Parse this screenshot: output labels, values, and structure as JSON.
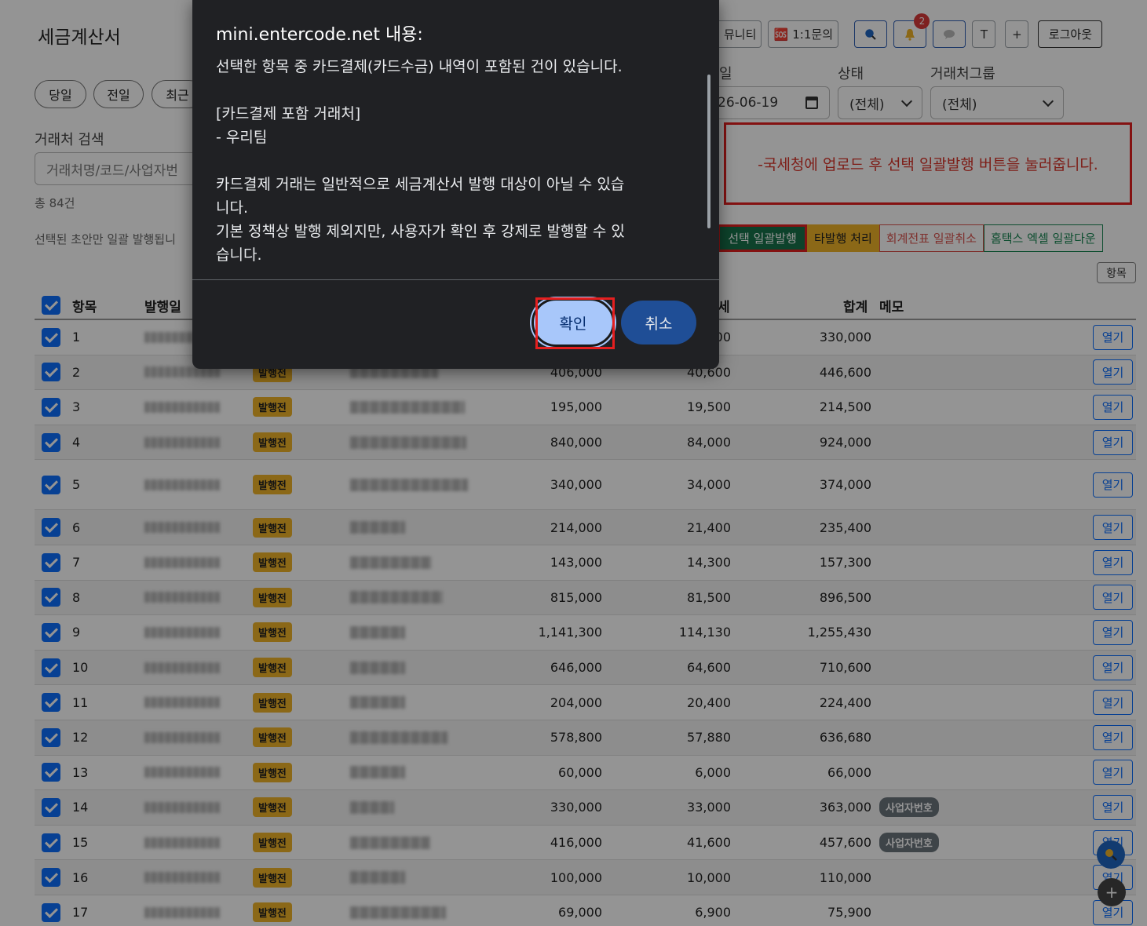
{
  "page": {
    "title": "세금계산서"
  },
  "top_actions": {
    "community": "뮤니티",
    "inquiry": "🆘 1:1문의",
    "search_icon": "search-icon",
    "notifications": "2",
    "chat_icon": "chat-icon",
    "t_label": "T",
    "plus_label": "+",
    "logout": "로그아웃"
  },
  "date_chips": [
    "당일",
    "전일",
    "최근"
  ],
  "filters": {
    "date_partial_label": "일",
    "date_value": "26-06-19",
    "status_label": "상태",
    "status_value": "(전체)",
    "group_label": "거래처그룹",
    "group_value": "(전체)"
  },
  "search": {
    "label": "거래처 검색",
    "placeholder": "거래처명/코드/사업자번"
  },
  "total_count": "총 84건",
  "hint": "선택된 초안만 일괄 발행됩니",
  "annotation": "-국세청에 업로드 후 선택 일괄발행 버튼을 눌러줍니다.",
  "actions": {
    "batch_issue": "선택 일괄발행",
    "other_issue": "타발행 처리",
    "cancel_voucher": "회계전표 일괄취소",
    "hometax_download": "홈택스 엑셀 일괄다운"
  },
  "columns_button": "항목",
  "table": {
    "headers": {
      "item": "항목",
      "issue_date": "발행일",
      "tax": "세",
      "total": "합계",
      "memo": "메모"
    },
    "status_label": "발행전",
    "open_label": "열기",
    "rows": [
      {
        "no": "1",
        "supply": "",
        "tax": "00",
        "total": "330,000",
        "memo": ""
      },
      {
        "no": "2",
        "supply": "406,000",
        "tax": "40,600",
        "total": "446,600",
        "memo": ""
      },
      {
        "no": "3",
        "supply": "195,000",
        "tax": "19,500",
        "total": "214,500",
        "memo": ""
      },
      {
        "no": "4",
        "supply": "840,000",
        "tax": "84,000",
        "total": "924,000",
        "memo": ""
      },
      {
        "no": "5",
        "supply": "340,000",
        "tax": "34,000",
        "total": "374,000",
        "memo": ""
      },
      {
        "no": "6",
        "supply": "214,000",
        "tax": "21,400",
        "total": "235,400",
        "memo": ""
      },
      {
        "no": "7",
        "supply": "143,000",
        "tax": "14,300",
        "total": "157,300",
        "memo": ""
      },
      {
        "no": "8",
        "supply": "815,000",
        "tax": "81,500",
        "total": "896,500",
        "memo": ""
      },
      {
        "no": "9",
        "supply": "1,141,300",
        "tax": "114,130",
        "total": "1,255,430",
        "memo": ""
      },
      {
        "no": "10",
        "supply": "646,000",
        "tax": "64,600",
        "total": "710,600",
        "memo": ""
      },
      {
        "no": "11",
        "supply": "204,000",
        "tax": "20,400",
        "total": "224,400",
        "memo": ""
      },
      {
        "no": "12",
        "supply": "578,800",
        "tax": "57,880",
        "total": "636,680",
        "memo": ""
      },
      {
        "no": "13",
        "supply": "60,000",
        "tax": "6,000",
        "total": "66,000",
        "memo": ""
      },
      {
        "no": "14",
        "supply": "330,000",
        "tax": "33,000",
        "total": "363,000",
        "memo": "사업자번호"
      },
      {
        "no": "15",
        "supply": "416,000",
        "tax": "41,600",
        "total": "457,600",
        "memo": "사업자번호"
      },
      {
        "no": "16",
        "supply": "100,000",
        "tax": "10,000",
        "total": "110,000",
        "memo": ""
      },
      {
        "no": "17",
        "supply": "69,000",
        "tax": "6,900",
        "total": "75,900",
        "memo": ""
      }
    ]
  },
  "dialog": {
    "title": "mini.entercode.net 내용:",
    "message": "선택한 항목 중 카드결제(카드수금) 내역이 포함된 건이 있습니다.\n\n[카드결제 포함 거래처]\n- 우리팀\n\n카드결제 거래는 일반적으로 세금계산서 발행 대상이 아닐 수 있습\n니다.\n기본 정책상 발행 제외지만, 사용자가 확인 후 강제로 발행할 수 있\n습니다.",
    "ok_label": "확인",
    "cancel_label": "취소"
  },
  "colors": {
    "accent": "#0d6efd",
    "status": "#f0b429",
    "highlight": "#e41f1f"
  }
}
